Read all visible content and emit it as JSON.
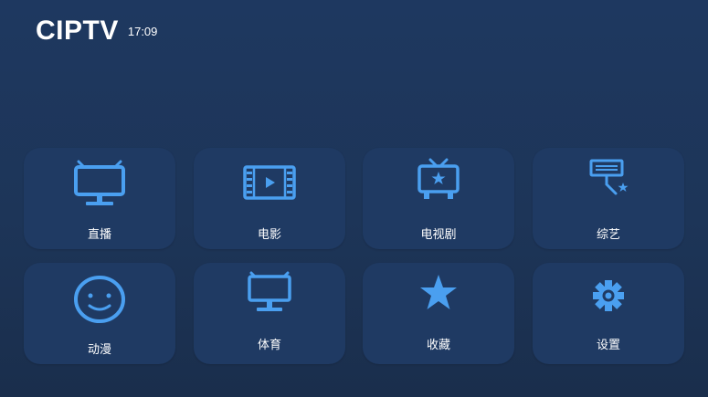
{
  "header": {
    "title": "CIPTV",
    "time": "17:09"
  },
  "colors": {
    "accent": "#4a9ff0",
    "tile_background": "#1f3a63",
    "page_background": "#1d3558"
  },
  "tiles": [
    {
      "label": "直播",
      "icon": "tv-icon"
    },
    {
      "label": "电影",
      "icon": "film-icon"
    },
    {
      "label": "电视剧",
      "icon": "tv-star-icon"
    },
    {
      "label": "综艺",
      "icon": "spotlight-icon"
    },
    {
      "label": "动漫",
      "icon": "smiley-icon"
    },
    {
      "label": "体育",
      "icon": "monitor-icon"
    },
    {
      "label": "收藏",
      "icon": "star-icon"
    },
    {
      "label": "设置",
      "icon": "gear-icon"
    }
  ]
}
